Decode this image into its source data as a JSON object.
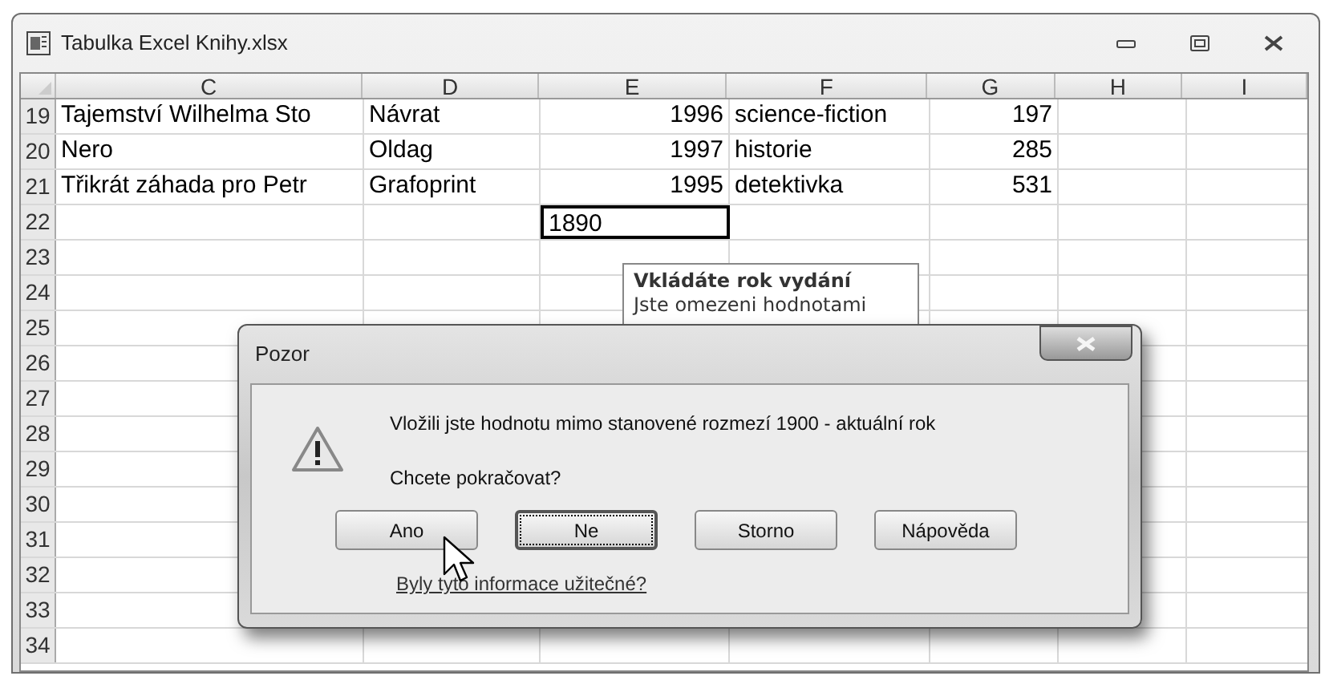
{
  "window": {
    "title": "Tabulka Excel Knihy.xlsx"
  },
  "columns": [
    "C",
    "D",
    "E",
    "F",
    "G",
    "H",
    "I"
  ],
  "rows": [
    {
      "number": "19",
      "cells": [
        {
          "text": "Tajemství Wilhelma Sto",
          "kind": "text",
          "selected": false
        },
        {
          "text": "Návrat",
          "kind": "text",
          "selected": false
        },
        {
          "text": "1996",
          "kind": "number",
          "selected": false
        },
        {
          "text": "science-fiction",
          "kind": "text",
          "selected": false
        },
        {
          "text": "197",
          "kind": "number",
          "selected": false
        }
      ]
    },
    {
      "number": "20",
      "cells": [
        {
          "text": "Nero",
          "kind": "text",
          "selected": false
        },
        {
          "text": "Oldag",
          "kind": "text",
          "selected": false
        },
        {
          "text": "1997",
          "kind": "number",
          "selected": false
        },
        {
          "text": "historie",
          "kind": "text",
          "selected": false
        },
        {
          "text": "285",
          "kind": "number",
          "selected": false
        }
      ]
    },
    {
      "number": "21",
      "cells": [
        {
          "text": "Třikrát záhada pro Petr",
          "kind": "text",
          "selected": false
        },
        {
          "text": "Grafoprint",
          "kind": "text",
          "selected": false
        },
        {
          "text": "1995",
          "kind": "number",
          "selected": false
        },
        {
          "text": "detektivka",
          "kind": "text",
          "selected": false
        },
        {
          "text": "531",
          "kind": "number",
          "selected": false
        }
      ]
    },
    {
      "number": "22",
      "cells": [
        {
          "kind": "empty",
          "selected": false
        },
        {
          "kind": "empty",
          "selected": false
        },
        {
          "text": "1890",
          "kind": "text",
          "selected": true
        }
      ]
    },
    {
      "number": "23",
      "cells": []
    },
    {
      "number": "24",
      "cells": []
    },
    {
      "number": "25",
      "cells": []
    },
    {
      "number": "26",
      "cells": []
    },
    {
      "number": "27",
      "cells": []
    },
    {
      "number": "28",
      "cells": []
    },
    {
      "number": "29",
      "cells": []
    },
    {
      "number": "30",
      "cells": []
    },
    {
      "number": "31",
      "cells": []
    },
    {
      "number": "32",
      "cells": []
    },
    {
      "number": "33",
      "cells": []
    },
    {
      "number": "34",
      "cells": []
    }
  ],
  "tooltip": {
    "title": "Vkládáte rok vydání",
    "text": "Jste omezeni hodnotami"
  },
  "dialog": {
    "title": "Pozor",
    "message": "Vložili jste hodnotu mimo stanovené rozmezí 1900 - aktuální rok",
    "question": "Chcete pokračovat?",
    "buttons": [
      {
        "label": "Ano",
        "focused": false
      },
      {
        "label": "Ne",
        "focused": true
      },
      {
        "label": "Storno",
        "focused": false
      },
      {
        "label": "Nápověda",
        "focused": false
      }
    ],
    "link": "Byly tyto informace užitečné?"
  }
}
